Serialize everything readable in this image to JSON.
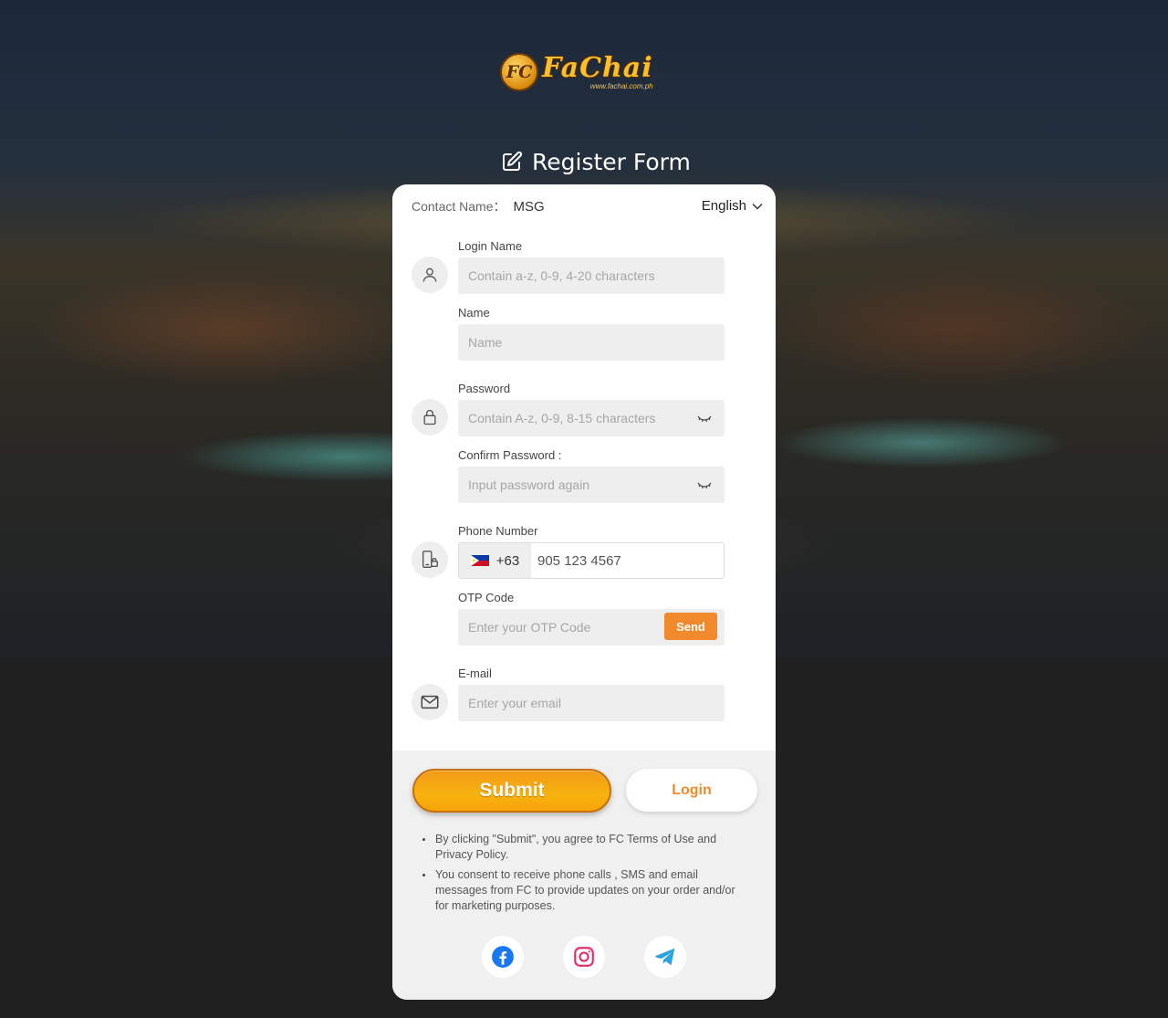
{
  "brand": {
    "logo_badge": "FC",
    "logo_word": "FaChai",
    "logo_url": "www.fachai.com.ph"
  },
  "header": {
    "title": "Register Form"
  },
  "contact": {
    "label": "Contact Name：",
    "value": "MSG"
  },
  "language": {
    "selected": "English"
  },
  "fields": {
    "login_name": {
      "label": "Login Name",
      "placeholder": "Contain a-z, 0-9, 4-20 characters"
    },
    "name": {
      "label": "Name",
      "placeholder": "Name"
    },
    "password": {
      "label": "Password",
      "placeholder": "Contain A-z, 0-9, 8-15 characters"
    },
    "confirm_password": {
      "label": "Confirm Password :",
      "placeholder": "Input password again"
    },
    "phone": {
      "label": "Phone Number",
      "prefix": "+63",
      "placeholder": "905 123 4567"
    },
    "otp": {
      "label": "OTP Code",
      "placeholder": "Enter your OTP Code",
      "send_label": "Send"
    },
    "email": {
      "label": "E-mail",
      "placeholder": "Enter your email"
    }
  },
  "actions": {
    "submit_label": "Submit",
    "login_label": "Login"
  },
  "notes": [
    "By clicking \"Submit\", you agree to FC Terms of Use and Privacy Policy.",
    "You consent to receive phone calls , SMS and email messages from FC to provide updates on your order and/or for marketing purposes."
  ],
  "social": [
    "facebook-icon",
    "instagram-icon",
    "telegram-icon"
  ],
  "colors": {
    "accent": "#f08a2c",
    "submit": "#f7b30f",
    "facebook": "#1877f2",
    "instagram": "#e1306c",
    "telegram": "#2aa3e0"
  }
}
